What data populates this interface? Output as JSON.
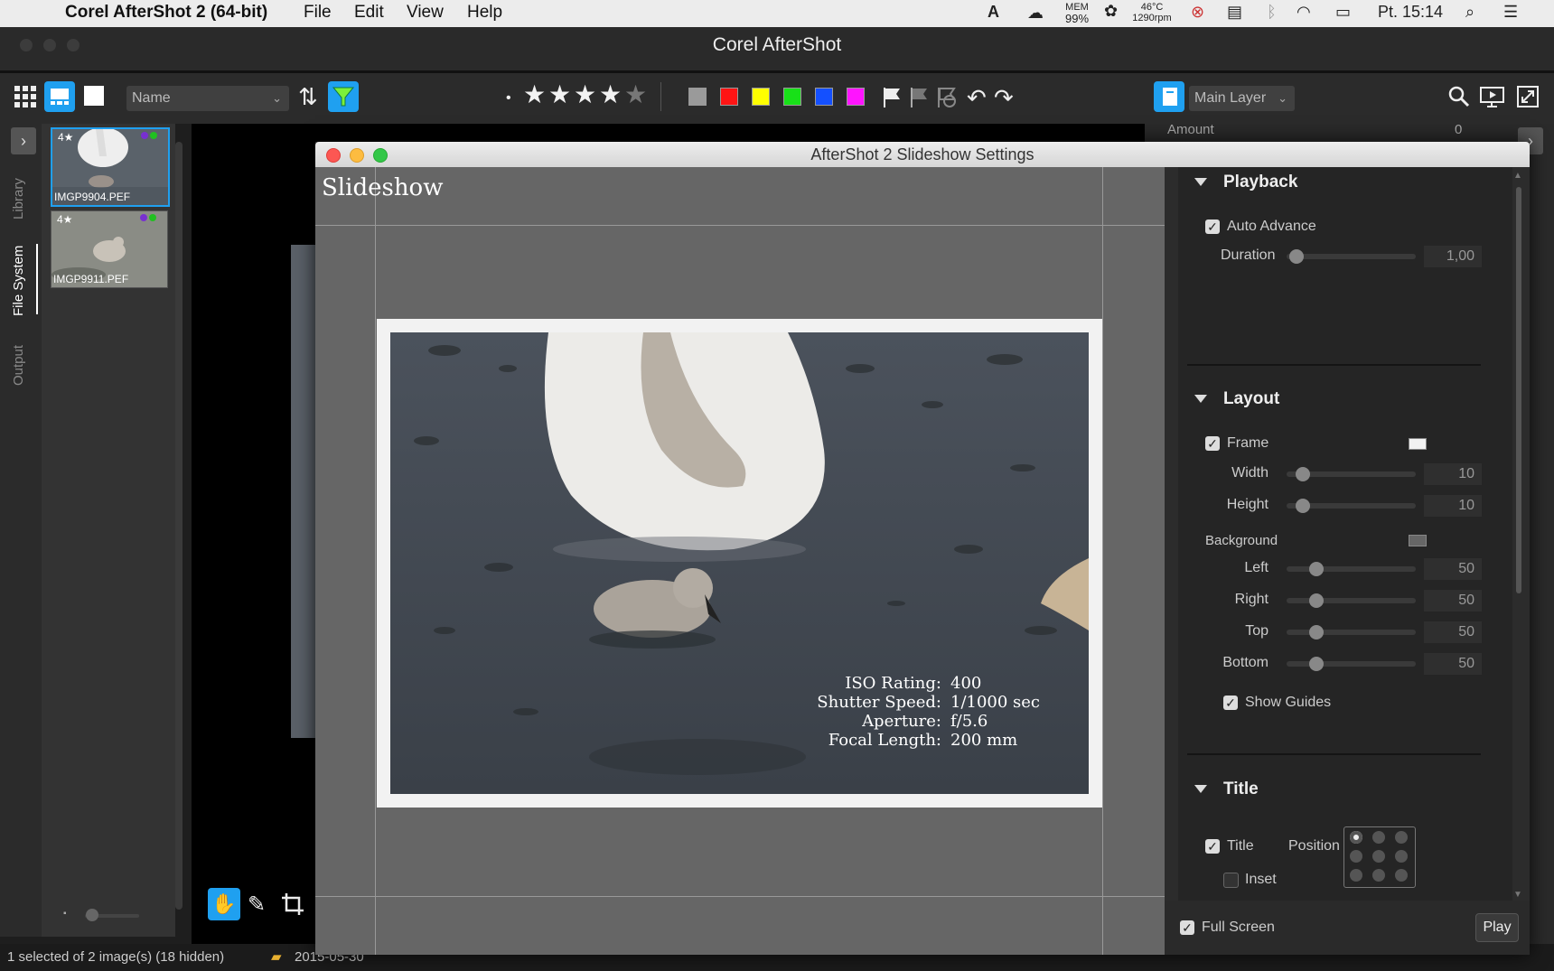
{
  "menubar": {
    "app_name": "Corel AfterShot 2 (64-bit)",
    "items": [
      "File",
      "Edit",
      "View",
      "Help"
    ],
    "mem_label": "MEM",
    "mem_value": "99%",
    "temp": "46°C",
    "rpm": "1290rpm",
    "clock": "Pt. 15:14"
  },
  "window": {
    "title": "Corel AfterShot"
  },
  "toolbar": {
    "sort_select": "Name",
    "layer_select": "Main Layer",
    "rating_dot": "•",
    "stars": [
      "★",
      "★",
      "★",
      "★",
      "★"
    ],
    "color_labels": [
      "#9a9a9a",
      "#ff1414",
      "#ffff00",
      "#18e018",
      "#1450ff",
      "#ff14ff"
    ]
  },
  "left_tabs": [
    "Library",
    "File System",
    "Output"
  ],
  "filmstrip": {
    "items": [
      {
        "name": "IMGP9904.PEF",
        "rating": "4★",
        "selected": true
      },
      {
        "name": "IMGP9911.PEF",
        "rating": "4★",
        "selected": false
      }
    ]
  },
  "right_panel_peek": {
    "label": "Amount",
    "value": "0"
  },
  "statusbar": {
    "selection": "1 selected of 2 image(s) (18 hidden)",
    "folder": "2015-05-30"
  },
  "dialog": {
    "title": "AfterShot 2 Slideshow Settings",
    "stage_title": "Slideshow",
    "exif": [
      {
        "k": "ISO Rating:",
        "v": "400"
      },
      {
        "k": "Shutter Speed:",
        "v": "1/1000 sec"
      },
      {
        "k": "Aperture:",
        "v": "f/5.6"
      },
      {
        "k": "Focal Length:",
        "v": "200 mm"
      }
    ],
    "playback": {
      "header": "Playback",
      "auto_advance": "Auto Advance",
      "auto_advance_checked": true,
      "duration_label": "Duration",
      "duration_value": "1,00",
      "duration_level": 0.05
    },
    "layout": {
      "header": "Layout",
      "frame_label": "Frame",
      "frame_checked": true,
      "frame_color": "#f2f2f2",
      "width_label": "Width",
      "width_value": "10",
      "width_level": 0.1,
      "height_label": "Height",
      "height_value": "10",
      "height_level": 0.1,
      "background_label": "Background",
      "background_color": "#666666",
      "left_label": "Left",
      "left_value": "50",
      "left_level": 0.2,
      "right_label": "Right",
      "right_value": "50",
      "right_level": 0.2,
      "top_label": "Top",
      "top_value": "50",
      "top_level": 0.2,
      "bottom_label": "Bottom",
      "bottom_value": "50",
      "bottom_level": 0.2,
      "show_guides": "Show Guides",
      "show_guides_checked": true
    },
    "title_section": {
      "header": "Title",
      "title_label": "Title",
      "title_checked": true,
      "position_label": "Position",
      "inset_label": "Inset",
      "inset_checked": false
    },
    "full_screen": "Full Screen",
    "full_screen_checked": true,
    "play_button": "Play"
  }
}
